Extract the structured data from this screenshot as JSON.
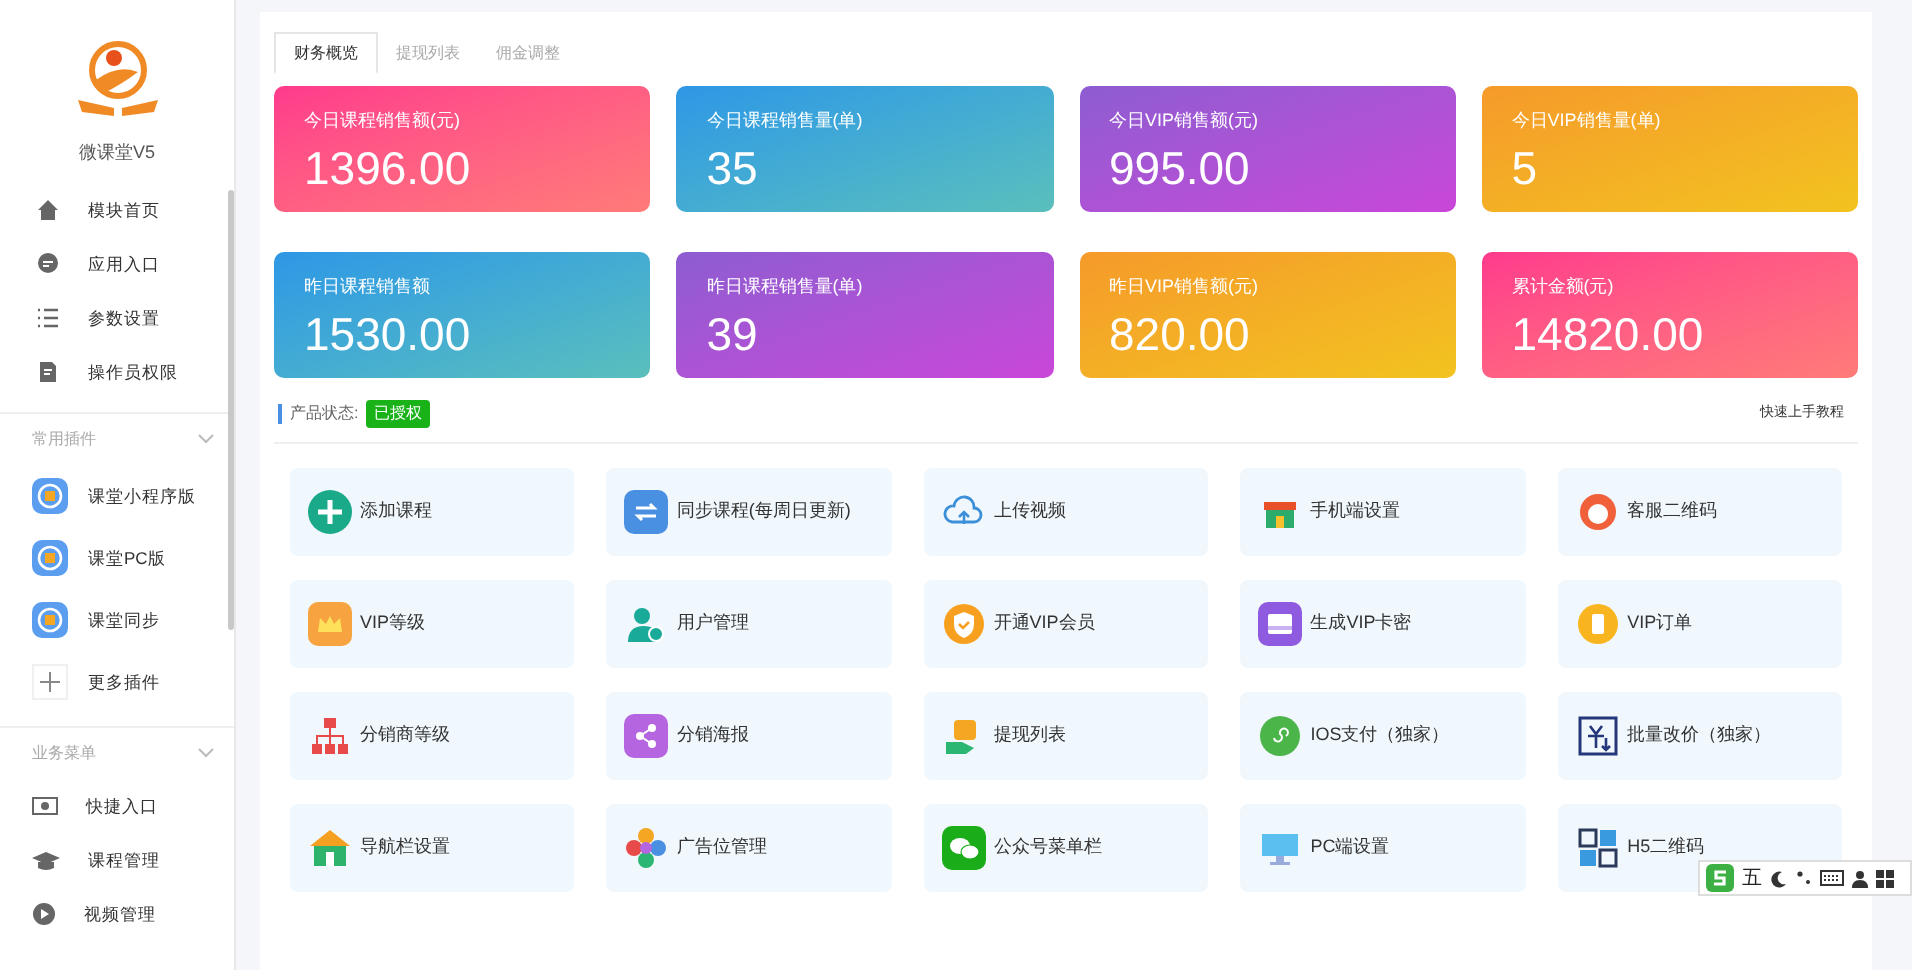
{
  "sidebar": {
    "logo_text": "微课堂V5",
    "items": [
      {
        "label": "模块首页"
      },
      {
        "label": "应用入口"
      },
      {
        "label": "参数设置"
      },
      {
        "label": "操作员权限"
      }
    ],
    "sections": [
      {
        "title": "常用插件",
        "expanded": true,
        "items": [
          {
            "label": "课堂小程序版",
            "kind": "plugin"
          },
          {
            "label": "课堂PC版",
            "kind": "plugin"
          },
          {
            "label": "课堂同步",
            "kind": "plugin"
          },
          {
            "label": "更多插件",
            "kind": "add"
          }
        ]
      },
      {
        "title": "业务菜单",
        "expanded": true,
        "items": [
          {
            "label": "快捷入口",
            "kind": "menu"
          },
          {
            "label": "课程管理",
            "kind": "menu"
          },
          {
            "label": "视频管理",
            "kind": "menu"
          }
        ]
      }
    ]
  },
  "tabs": [
    {
      "label": "财务概览",
      "selected": true
    },
    {
      "label": "提现列表",
      "selected": false
    },
    {
      "label": "佣金调整",
      "selected": false
    }
  ],
  "stats": [
    {
      "label": "今日课程销售额(元)",
      "value": "1396.00",
      "kind": "pink"
    },
    {
      "label": "今日课程销售量(单)",
      "value": "35",
      "kind": "blue"
    },
    {
      "label": "今日VIP销售额(元)",
      "value": "995.00",
      "kind": "purple"
    },
    {
      "label": "今日VIP销售量(单)",
      "value": "5",
      "kind": "orange"
    },
    {
      "label": "昨日课程销售额",
      "value": "1530.00",
      "kind": "blue"
    },
    {
      "label": "昨日课程销售量(单)",
      "value": "39",
      "kind": "purple"
    },
    {
      "label": "昨日VIP销售额(元)",
      "value": "820.00",
      "kind": "orange"
    },
    {
      "label": "累计金额(元)",
      "value": "14820.00",
      "kind": "pink"
    }
  ],
  "product_status": {
    "label": "产品状态:",
    "badge": "已授权",
    "link": "快速上手教程"
  },
  "shortcuts": [
    {
      "label": "添加课程"
    },
    {
      "label": "同步课程(每周日更新)"
    },
    {
      "label": "上传视频"
    },
    {
      "label": "手机端设置"
    },
    {
      "label": "客服二维码"
    },
    {
      "label": "VIP等级"
    },
    {
      "label": "用户管理"
    },
    {
      "label": "开通VIP会员"
    },
    {
      "label": "生成VIP卡密"
    },
    {
      "label": "VIP订单"
    },
    {
      "label": "分销商等级"
    },
    {
      "label": "分销海报"
    },
    {
      "label": "提现列表"
    },
    {
      "label": "IOS支付（独家）"
    },
    {
      "label": "批量改价（独家）"
    },
    {
      "label": "导航栏设置"
    },
    {
      "label": "广告位管理"
    },
    {
      "label": "公众号菜单栏"
    },
    {
      "label": "PC端设置"
    },
    {
      "label": "H5二维码"
    }
  ],
  "ime_toolbar": {
    "mode": "五"
  }
}
